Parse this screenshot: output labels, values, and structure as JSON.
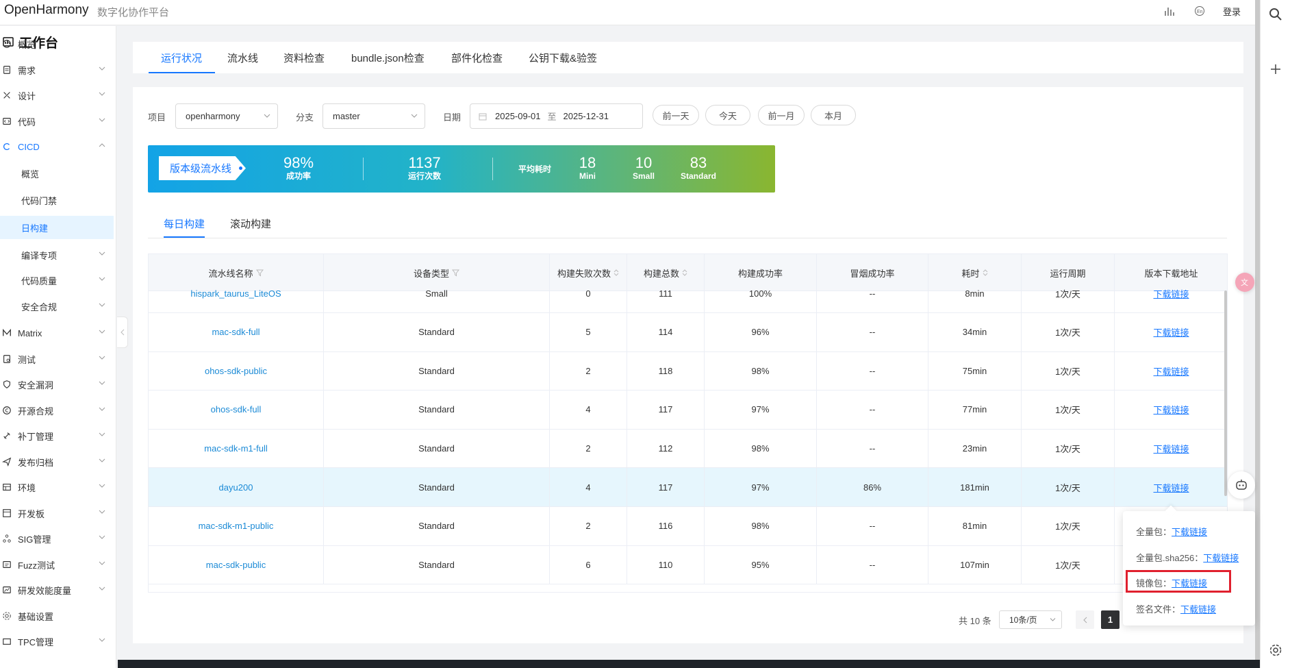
{
  "header": {
    "brand": "OpenHarmony",
    "subtitle": "数字化协作平台",
    "icons": [
      "bar-chart-icon",
      "language-icon"
    ],
    "login": "登录"
  },
  "right_strip": {
    "icons": [
      "search-icon",
      "plus-icon",
      "settings-icon"
    ]
  },
  "sidebar": {
    "title": "工作台",
    "items": [
      {
        "label": "概览",
        "icon": "dashboard-icon",
        "chevron": false
      },
      {
        "label": "需求",
        "icon": "requirement-icon",
        "chevron": true
      },
      {
        "label": "设计",
        "icon": "design-icon",
        "chevron": true
      },
      {
        "label": "代码",
        "icon": "code-icon",
        "chevron": true
      },
      {
        "label": "CICD",
        "icon": "cicd-icon",
        "chevron": true,
        "expanded": true
      },
      {
        "label": "概览",
        "sub": true,
        "chevron": false
      },
      {
        "label": "代码门禁",
        "sub": true,
        "chevron": false
      },
      {
        "label": "日构建",
        "sub": true,
        "chevron": false,
        "active": true
      },
      {
        "label": "编译专项",
        "sub": true,
        "chevron": true
      },
      {
        "label": "代码质量",
        "sub": true,
        "chevron": true
      },
      {
        "label": "安全合规",
        "sub": true,
        "chevron": true
      },
      {
        "label": "Matrix",
        "icon": "matrix-icon",
        "chevron": true
      },
      {
        "label": "测试",
        "icon": "test-icon",
        "chevron": true
      },
      {
        "label": "安全漏洞",
        "icon": "shield-icon",
        "chevron": true
      },
      {
        "label": "开源合规",
        "icon": "copyright-icon",
        "chevron": true
      },
      {
        "label": "补丁管理",
        "icon": "patch-icon",
        "chevron": true
      },
      {
        "label": "发布归档",
        "icon": "send-icon",
        "chevron": true
      },
      {
        "label": "环境",
        "icon": "environment-icon",
        "chevron": true
      },
      {
        "label": "开发板",
        "icon": "board-icon",
        "chevron": true
      },
      {
        "label": "SIG管理",
        "icon": "sig-icon",
        "chevron": true
      },
      {
        "label": "Fuzz测试",
        "icon": "fuzz-icon",
        "chevron": true
      },
      {
        "label": "研发效能度量",
        "icon": "metrics-icon",
        "chevron": true
      },
      {
        "label": "基础设置",
        "icon": "settings-icon",
        "chevron": false
      },
      {
        "label": "TPC管理",
        "icon": "tpc-icon",
        "chevron": true
      }
    ]
  },
  "tabs": [
    "运行状况",
    "流水线",
    "资料检查",
    "bundle.json检查",
    "部件化检查",
    "公钥下载&验签"
  ],
  "filters": {
    "project_label": "项目",
    "project_value": "openharmony",
    "branch_label": "分支",
    "branch_value": "master",
    "date_label": "日期",
    "date_start": "2025-09-01",
    "date_sep": "至",
    "date_end": "2025-12-31",
    "quick": [
      "前一天",
      "今天",
      "前一月",
      "本月"
    ]
  },
  "banner": {
    "tag": "版本级流水线",
    "success_rate": "98%",
    "success_rate_label": "成功率",
    "runs": "1137",
    "runs_label": "运行次数",
    "avg_label": "平均耗时",
    "mini": "18",
    "mini_label": "Mini",
    "small": "10",
    "small_label": "Small",
    "standard": "83",
    "standard_label": "Standard"
  },
  "subtabs": [
    "每日构建",
    "滚动构建"
  ],
  "table": {
    "headers": [
      "流水线名称",
      "设备类型",
      "构建失败次数",
      "构建总数",
      "构建成功率",
      "冒烟成功率",
      "耗时",
      "运行周期",
      "版本下载地址"
    ],
    "rows": [
      {
        "name": "hispark_taurus_LiteOS",
        "device": "Small",
        "fail": "0",
        "total": "111",
        "rate": "100%",
        "smoke": "--",
        "time": "8min",
        "cycle": "1次/天",
        "download": "下载链接"
      },
      {
        "name": "mac-sdk-full",
        "device": "Standard",
        "fail": "5",
        "total": "114",
        "rate": "96%",
        "smoke": "--",
        "time": "34min",
        "cycle": "1次/天",
        "download": "下载链接"
      },
      {
        "name": "ohos-sdk-public",
        "device": "Standard",
        "fail": "2",
        "total": "118",
        "rate": "98%",
        "smoke": "--",
        "time": "75min",
        "cycle": "1次/天",
        "download": "下载链接"
      },
      {
        "name": "ohos-sdk-full",
        "device": "Standard",
        "fail": "4",
        "total": "117",
        "rate": "97%",
        "smoke": "--",
        "time": "77min",
        "cycle": "1次/天",
        "download": "下载链接"
      },
      {
        "name": "mac-sdk-m1-full",
        "device": "Standard",
        "fail": "2",
        "total": "112",
        "rate": "98%",
        "smoke": "--",
        "time": "23min",
        "cycle": "1次/天",
        "download": "下载链接"
      },
      {
        "name": "dayu200",
        "device": "Standard",
        "fail": "4",
        "total": "117",
        "rate": "97%",
        "smoke": "86%",
        "time": "181min",
        "cycle": "1次/天",
        "download": "下载链接",
        "highlight": true
      },
      {
        "name": "mac-sdk-m1-public",
        "device": "Standard",
        "fail": "2",
        "total": "116",
        "rate": "98%",
        "smoke": "--",
        "time": "81min",
        "cycle": "1次/天",
        "download": ""
      },
      {
        "name": "mac-sdk-public",
        "device": "Standard",
        "fail": "6",
        "total": "110",
        "rate": "95%",
        "smoke": "--",
        "time": "107min",
        "cycle": "1次/天",
        "download": ""
      }
    ]
  },
  "pagination": {
    "total": "共 10 条",
    "page_size": "10条/页",
    "current": "1"
  },
  "popup": {
    "rows": [
      {
        "label": "全量包：",
        "link": "下载链接"
      },
      {
        "label": "全量包.sha256：",
        "link": "下载链接"
      },
      {
        "label": "镜像包：",
        "link": "下载链接"
      },
      {
        "label": "签名文件：",
        "link": "下载链接"
      }
    ]
  },
  "colors": {
    "accent": "#1677ff",
    "highlight_box": "#e0202e"
  }
}
